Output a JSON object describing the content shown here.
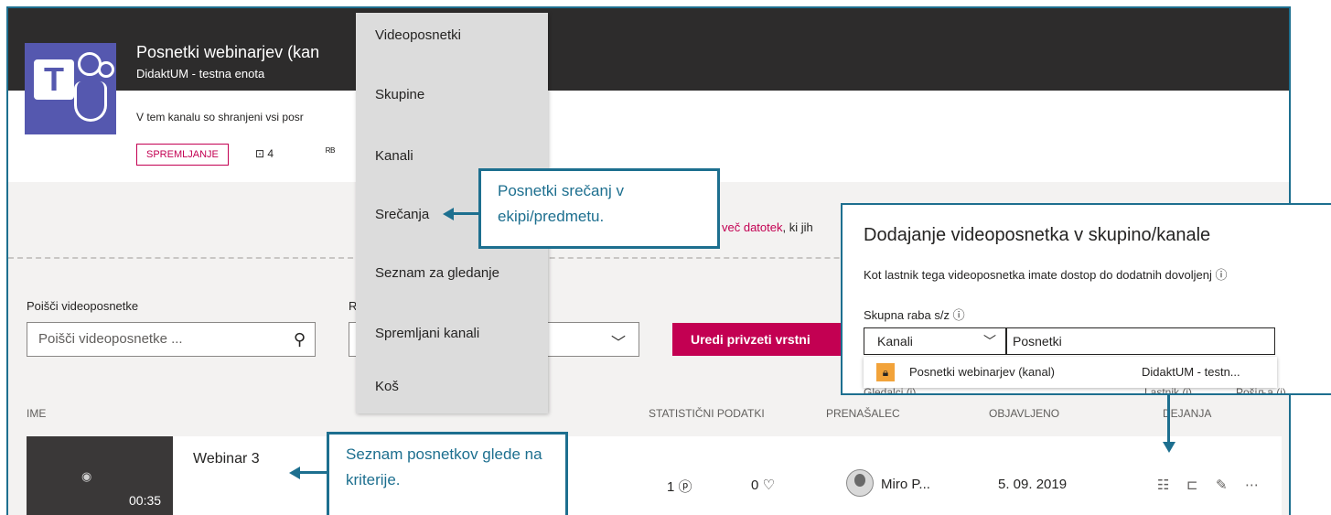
{
  "channel": {
    "title": "Posnetki webinarjev (kan",
    "subtitle": "DidaktUM - testna enota",
    "description": "V tem kanalu so shranjeni vsi posr",
    "follow_label": "SPREMLJANJE",
    "video_count": "4",
    "members_glyph": "ᴿᴮ"
  },
  "nav_menu": {
    "items": [
      "Videoposnetki",
      "Skupine",
      "Kanali",
      "Srečanja",
      "Seznam za gledanje",
      "Spremljani kanali",
      "Koš"
    ]
  },
  "upload_hint": {
    "link": "več datotek",
    "text": ", ki jih"
  },
  "search": {
    "label": "Poišči videoposnetke",
    "placeholder": "Poišči videoposnetke ..."
  },
  "sort": {
    "label": "R"
  },
  "edit_button_label": "Uredi privzeti vrstni",
  "columns": {
    "name": "IME",
    "stats": "STATISTIČNI PODATKI",
    "presenter": "PRENAŠALEC",
    "published": "OBJAVLJENO",
    "actions": "DEJANJA"
  },
  "videos": [
    {
      "title": "Webinar 3",
      "duration": "00:35",
      "views": "1",
      "likes": "0",
      "presenter": "Miro P...",
      "published": "5. 09. 2019"
    }
  ],
  "callouts": {
    "meetings": "Posnetki srečanj v ekipi/predmetu.",
    "list": "Seznam posnetkov glede na kriterije."
  },
  "dialog": {
    "title": "Dodajanje videoposnetka v skupino/kanale",
    "subtitle": "Kot lastnik tega videoposnetka imate dostop do dodatnih dovoljenj",
    "share_label": "Skupna raba s/z",
    "select_value": "Kanali",
    "input_value": "Posnetki",
    "option_name": "Posnetki webinarjev (kanal)",
    "option_team": "DidaktUM - testn...",
    "peek_viewers": "Gledalci (i)",
    "peek_owner": "Lastnik (i)",
    "peek_channel": "Pošiљa (i)"
  },
  "colors": {
    "accent": "#c30052",
    "teams_purple": "#5558af",
    "callout_blue": "#1d6f8f",
    "header_dark": "#2d2c2c"
  },
  "icons": {
    "search": "search-icon",
    "chevron": "chevron-down-icon",
    "video": "video-count-icon",
    "play": "play-circle-icon",
    "heart": "heart-icon",
    "info": "info-icon",
    "lock": "lock-icon",
    "list_remove": "remove-from-list-icon",
    "add_to_group": "add-to-group-icon",
    "edit": "pencil-icon",
    "more": "more-icon"
  }
}
